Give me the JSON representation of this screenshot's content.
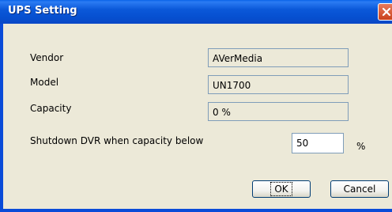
{
  "window": {
    "title": "UPS Setting"
  },
  "form": {
    "vendor_label": "Vendor",
    "vendor_value": "AVerMedia",
    "model_label": "Model",
    "model_value": "UN1700",
    "capacity_label": "Capacity",
    "capacity_value": "0 %",
    "shutdown_label": "Shutdown DVR when capacity below",
    "shutdown_value": "50",
    "shutdown_unit": "%"
  },
  "buttons": {
    "ok": "OK",
    "cancel": "Cancel"
  },
  "icons": {
    "close": "close-icon"
  },
  "colors": {
    "titlebar": "#0b58d9",
    "close_button": "#c9421d",
    "dialog_bg": "#ece9d8",
    "field_border": "#7f9db9"
  }
}
